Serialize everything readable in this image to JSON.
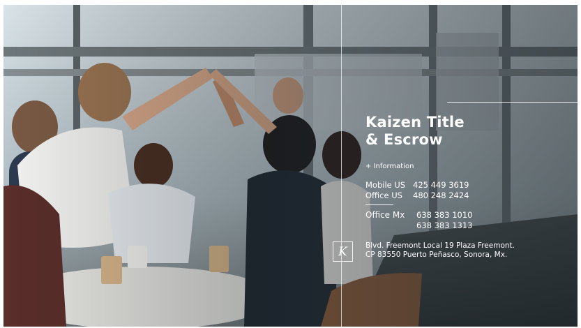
{
  "brand": {
    "title_line1": "Kaizen Title",
    "title_line2": "& Escrow",
    "logo_letter": "K"
  },
  "contact": {
    "info_label": "+ Information",
    "mobile_us_label": "Mobile US",
    "mobile_us_value": "425 449 3619",
    "office_us_label": "Office US",
    "office_us_value": "480 248 2424",
    "office_mx_label": "Office Mx",
    "office_mx_value_1": "638 383 1010",
    "office_mx_value_2": "638 383 1313"
  },
  "address": {
    "line1": "Blvd. Freemont Local 19 Plaza Freemont.",
    "line2": "CP 83550  Puerto Peñasco, Sonora, Mx."
  },
  "colors": {
    "text": "#ffffff",
    "overlay": "#3a4347"
  }
}
